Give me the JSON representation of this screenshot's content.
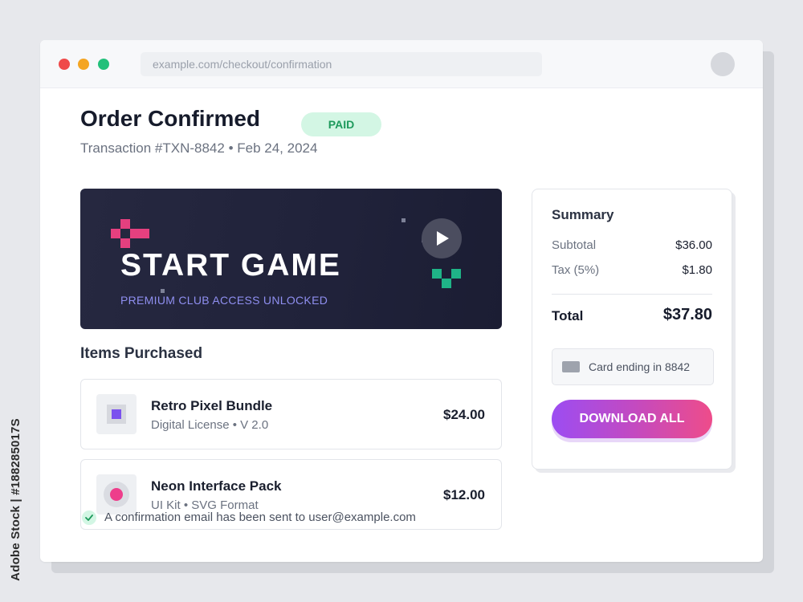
{
  "browser": {
    "url": "example.com/checkout/confirmation"
  },
  "order": {
    "title": "Order Confirmed",
    "status_badge": "PAID",
    "transaction": "Transaction #TXN-8842 • Feb 24, 2024"
  },
  "banner": {
    "title": "START GAME",
    "subtitle": "PREMIUM CLUB ACCESS UNLOCKED",
    "play_icon": "play-icon"
  },
  "items_section": {
    "title": "Items Purchased",
    "items": [
      {
        "name": "Retro Pixel Bundle",
        "meta": "Digital License • V 2.0",
        "price": "$24.00",
        "icon": "pixel-square-icon"
      },
      {
        "name": "Neon Interface Pack",
        "meta": "UI Kit • SVG Format",
        "price": "$12.00",
        "icon": "neon-circle-icon"
      }
    ]
  },
  "notice": {
    "text": "A confirmation email has been sent to user@example.com",
    "icon": "check-icon"
  },
  "summary": {
    "title": "Summary",
    "subtotal_label": "Subtotal",
    "subtotal_value": "$36.00",
    "tax_label": "Tax (5%)",
    "tax_value": "$1.80",
    "total_label": "Total",
    "total_value": "$37.80",
    "card_text": "Card ending in 8842",
    "download_label": "DOWNLOAD ALL"
  },
  "watermark": {
    "side_text": "Adobe Stock | #188285017S"
  },
  "colors": {
    "accent_gradient_start": "#9c4df2",
    "accent_gradient_end": "#ee4c8a",
    "paid_badge_bg": "#d3f6e4",
    "paid_badge_text": "#1e9a5c",
    "banner_bg": "#20223a",
    "pixel_pink": "#e5407f",
    "pixel_teal": "#1fb487"
  }
}
